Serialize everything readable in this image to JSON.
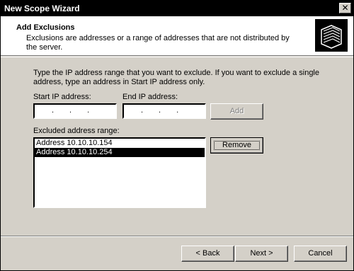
{
  "window": {
    "title": "New Scope Wizard",
    "close_label": "✕"
  },
  "header": {
    "title": "Add Exclusions",
    "description": "Exclusions are addresses or a range of addresses that are not distributed by the server.",
    "icon": "folders-icon"
  },
  "instructions": "Type the IP address range that you want to exclude. If you want to exclude a single address, type an address in Start IP address only.",
  "start_ip": {
    "label": "Start IP address:",
    "value": ""
  },
  "end_ip": {
    "label": "End IP address:",
    "value": ""
  },
  "add_button": "Add",
  "excluded": {
    "label": "Excluded address range:",
    "items": [
      "Address 10.10.10.154",
      "Address 10.10.10.254"
    ],
    "selected_index": 1
  },
  "remove_button": "Remove",
  "footer": {
    "back": "< Back",
    "next": "Next >",
    "cancel": "Cancel"
  }
}
